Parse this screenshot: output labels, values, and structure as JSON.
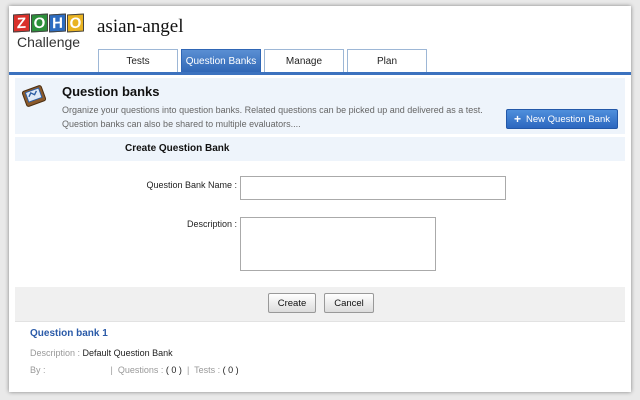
{
  "header": {
    "logo_letters": [
      "Z",
      "O",
      "H",
      "O"
    ],
    "logo_colors": [
      "#d9302a",
      "#2c8f3a",
      "#2d6cc0",
      "#e9b322"
    ],
    "logo_sub": "Challenge",
    "title": "asian-angel"
  },
  "tabs": [
    {
      "label": "Tests",
      "active": false
    },
    {
      "label": "Question Banks",
      "active": true
    },
    {
      "label": "Manage",
      "active": false
    },
    {
      "label": "Plan",
      "active": false
    }
  ],
  "section": {
    "icon": "question-bank-icon",
    "title": "Question banks",
    "description": "Organize your questions into question banks. Related questions can be picked up and delivered as a test. Question banks can also be shared to multiple evaluators....",
    "new_button": "New Question Bank"
  },
  "form": {
    "title": "Create Question Bank",
    "name_label": "Question Bank Name :",
    "name_value": "",
    "desc_label": "Description :",
    "desc_value": "",
    "create_label": "Create",
    "cancel_label": "Cancel"
  },
  "banks": [
    {
      "name": "Question bank 1",
      "desc_label": "Description :",
      "desc_value": "Default Question Bank",
      "by_label": "By :",
      "questions_label": "Questions :",
      "questions_value": "( 0 )",
      "tests_label": "Tests :",
      "tests_value": "( 0 )"
    }
  ],
  "colors": {
    "accent": "#3c72bf",
    "link": "#2a5aa8"
  }
}
